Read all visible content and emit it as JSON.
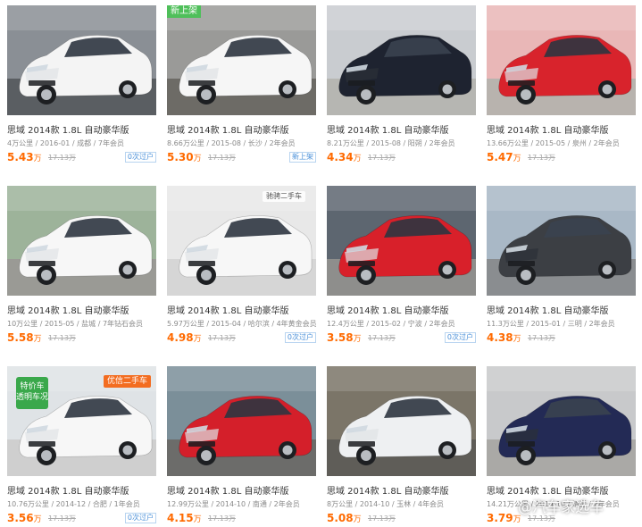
{
  "listings": [
    {
      "title": "思域 2014款 1.8L 自动豪华版",
      "meta": "4万公里 / 2016-01 / 成都 / 7年会员",
      "price": "5.43",
      "unit": "万",
      "orig": "17.13万",
      "tag": "0次过户",
      "badge": "",
      "colors": {
        "body": "#f4f4f4",
        "bg": "#8a8f95",
        "ground": "#5a5e62"
      }
    },
    {
      "title": "思域 2014款 1.8L 自动豪华版",
      "meta": "8.66万公里 / 2015-08 / 长沙 / 2年会员",
      "price": "5.30",
      "unit": "万",
      "orig": "17.13万",
      "tag": "新上架",
      "badge": "新上架",
      "colors": {
        "body": "#f6f6f6",
        "bg": "#9a9a98",
        "ground": "#6d6b66"
      }
    },
    {
      "title": "思域 2014款 1.8L 自动豪华版",
      "meta": "8.21万公里 / 2015-08 / 阳朔 / 2年会员",
      "price": "4.34",
      "unit": "万",
      "orig": "17.13万",
      "tag": "",
      "badge": "",
      "colors": {
        "body": "#1e2330",
        "bg": "#c9ccd0",
        "ground": "#b6b6b2"
      }
    },
    {
      "title": "思域 2014款 1.8L 自动豪华版",
      "meta": "13.66万公里 / 2015-05 / 泉州 / 2年会员",
      "price": "5.47",
      "unit": "万",
      "orig": "17.13万",
      "tag": "",
      "badge": "",
      "colors": {
        "body": "#d8232c",
        "bg": "#e9b7b7",
        "ground": "#b8b3ae"
      }
    },
    {
      "title": "思域 2014款 1.8L 自动豪华版",
      "meta": "10万公里 / 2015-05 / 盐城 / 7年钻石会员",
      "price": "5.58",
      "unit": "万",
      "orig": "17.13万",
      "tag": "",
      "badge": "",
      "colors": {
        "body": "#f7f7f7",
        "bg": "#9db39a",
        "ground": "#9a9a95"
      }
    },
    {
      "title": "思域 2014款 1.8L 自动豪华版",
      "meta": "5.97万公里 / 2015-04 / 哈尔滨 / 4年黄金会员",
      "price": "4.98",
      "unit": "万",
      "orig": "17.13万",
      "tag": "0次过户",
      "badge": "",
      "colors": {
        "body": "#f7f7f7",
        "bg": "#e8e8e8",
        "ground": "#d6d6d6"
      }
    },
    {
      "title": "思域 2014款 1.8L 自动豪华版",
      "meta": "12.4万公里 / 2015-02 / 宁波 / 2年会员",
      "price": "3.58",
      "unit": "万",
      "orig": "17.13万",
      "tag": "0次过户",
      "badge": "",
      "colors": {
        "body": "#d8202a",
        "bg": "#5d6670",
        "ground": "#8e8e8c"
      }
    },
    {
      "title": "思域 2014款 1.8L 自动豪华版",
      "meta": "11.3万公里 / 2015-01 / 三明 / 2年会员",
      "price": "4.38",
      "unit": "万",
      "orig": "17.13万",
      "tag": "",
      "badge": "",
      "colors": {
        "body": "#3c3f44",
        "bg": "#a9b8c6",
        "ground": "#8a8d90"
      }
    },
    {
      "title": "思域 2014款 1.8L 自动豪华版",
      "meta": "10.76万公里 / 2014-12 / 合肥 / 1年会员",
      "price": "3.56",
      "unit": "万",
      "orig": "17.13万",
      "tag": "0次过户",
      "badge": "",
      "colors": {
        "body": "#f7f7f7",
        "bg": "#dfe3e6",
        "ground": "#cfcfcf"
      }
    },
    {
      "title": "思域 2014款 1.8L 自动豪华版",
      "meta": "12.99万公里 / 2014-10 / 南通 / 2年会员",
      "price": "4.15",
      "unit": "万",
      "orig": "17.13万",
      "tag": "",
      "badge": "",
      "colors": {
        "body": "#d41f2a",
        "bg": "#7b8f99",
        "ground": "#6c6c6a"
      }
    },
    {
      "title": "思域 2014款 1.8L 自动豪华版",
      "meta": "8万公里 / 2014-10 / 玉林 / 4年会员",
      "price": "5.08",
      "unit": "万",
      "orig": "17.13万",
      "tag": "",
      "badge": "",
      "colors": {
        "body": "#eef0f2",
        "bg": "#7b7568",
        "ground": "#5f5d58"
      }
    },
    {
      "title": "思域 2014款 1.8L 自动豪华版",
      "meta": "14.21万公里 / 2014-10 / 清远 / 2年会员",
      "price": "3.79",
      "unit": "万",
      "orig": "17.13万",
      "tag": "",
      "badge": "",
      "colors": {
        "body": "#232a55",
        "bg": "#c8c9cb",
        "ground": "#aaa9a6"
      }
    }
  ],
  "overlays": {
    "promo_tag": "特价车 透明车况",
    "promo_logo": "优信二手车",
    "dealer_wm": "驰骋二手车",
    "page_watermark": "@汽车家选车"
  }
}
